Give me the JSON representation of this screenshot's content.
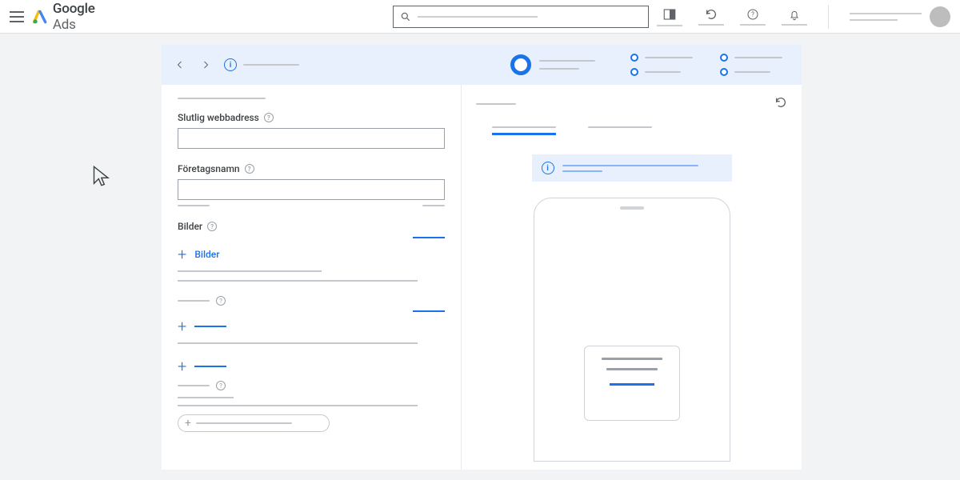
{
  "brand": {
    "name_bold": "Google",
    "name_light": "Ads"
  },
  "form": {
    "final_url_label": "Slutlig webbadress",
    "business_name_label": "Företagsnamn",
    "images_section_label": "Bilder",
    "add_images_label": "Bilder"
  }
}
